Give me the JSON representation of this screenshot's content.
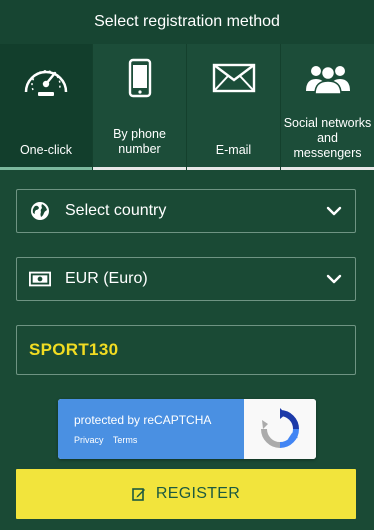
{
  "header": {
    "title": "Select registration method"
  },
  "tabs": [
    {
      "label": "One-click",
      "icon": "speedometer-icon",
      "active": true
    },
    {
      "label": "By phone number",
      "icon": "phone-icon",
      "active": false
    },
    {
      "label": "E-mail",
      "icon": "envelope-icon",
      "active": false
    },
    {
      "label": "Social networks and messengers",
      "icon": "people-icon",
      "active": false
    }
  ],
  "form": {
    "country": {
      "value": "Select country",
      "icon": "globe-icon"
    },
    "currency": {
      "value": "EUR (Euro)",
      "icon": "banknote-icon"
    },
    "promo_code": {
      "value": "SPORT130"
    }
  },
  "captcha": {
    "title": "protected by reCAPTCHA",
    "privacy": "Privacy",
    "terms": "Terms"
  },
  "register_button": {
    "label": "REGISTER",
    "icon": "edit-icon"
  },
  "colors": {
    "background": "#1a4a35",
    "accent_yellow": "#f2e43c",
    "promo_text": "#f1dc22",
    "captcha_blue": "#4a90e2"
  }
}
